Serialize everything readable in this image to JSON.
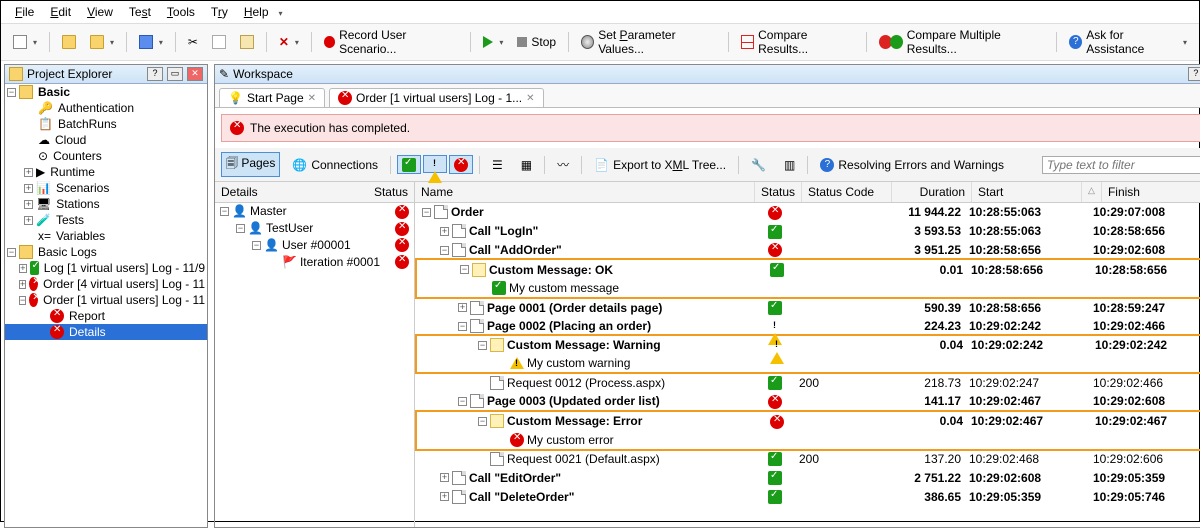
{
  "menu": {
    "file": "File",
    "edit": "Edit",
    "view": "View",
    "test": "Test",
    "tools": "Tools",
    "try": "Try",
    "help": "Help"
  },
  "toolbar": {
    "record": "Record User Scenario...",
    "stop": "Stop",
    "param": "Set Parameter Values...",
    "compare": "Compare Results...",
    "compareMulti": "Compare Multiple Results...",
    "ask": "Ask for Assistance"
  },
  "explorer": {
    "title": "Project Explorer",
    "basic": "Basic",
    "items": [
      "Authentication",
      "BatchRuns",
      "Cloud",
      "Counters",
      "Runtime",
      "Scenarios",
      "Stations",
      "Tests",
      "Variables"
    ],
    "logsTitle": "Basic Logs",
    "logs": [
      "Log [1 virtual users] Log -  11/9",
      "Order [4 virtual users] Log -  11",
      "Order [1 virtual users] Log -  11"
    ],
    "logChildren": [
      "Report",
      "Details"
    ]
  },
  "workspace": {
    "title": "Workspace",
    "tabs": [
      {
        "label": "Start Page"
      },
      {
        "label": "Order [1 virtual users] Log -  1..."
      }
    ],
    "banner": "The execution has completed.",
    "filter": {
      "pages": "Pages",
      "connections": "Connections",
      "export": "Export to XML Tree...",
      "resolving": "Resolving Errors and Warnings",
      "searchPlaceholder": "Type text to filter"
    },
    "detailsHdr": {
      "details": "Details",
      "status": "Status"
    },
    "details": [
      {
        "indent": 0,
        "exp": "-",
        "icon": "user",
        "label": "Master",
        "status": "err"
      },
      {
        "indent": 1,
        "exp": "-",
        "icon": "users",
        "label": "TestUser",
        "status": "err"
      },
      {
        "indent": 2,
        "exp": "-",
        "icon": "user",
        "label": "User #00001",
        "status": "err"
      },
      {
        "indent": 3,
        "exp": "",
        "icon": "flag",
        "label": "Iteration #0001",
        "status": "err"
      }
    ],
    "gridHdr": {
      "name": "Name",
      "status": "Status",
      "code": "Status Code",
      "dur": "Duration",
      "start": "Start",
      "finish": "Finish"
    },
    "rows": [
      {
        "i": 0,
        "exp": "-",
        "icon": "page",
        "bold": true,
        "name": "Order",
        "st": "err",
        "code": "",
        "dur": "11 944.22",
        "start": "10:28:55:063",
        "fin": "10:29:07:008"
      },
      {
        "i": 1,
        "exp": "+",
        "icon": "page",
        "bold": true,
        "name": "Call \"LogIn\"",
        "st": "ok",
        "code": "",
        "dur": "3 593.53",
        "start": "10:28:55:063",
        "fin": "10:28:58:656"
      },
      {
        "i": 1,
        "exp": "-",
        "icon": "page",
        "bold": true,
        "name": "Call \"AddOrder\"",
        "st": "err",
        "code": "",
        "dur": "3 951.25",
        "start": "10:28:58:656",
        "fin": "10:29:02:608"
      },
      {
        "i": 2,
        "exp": "-",
        "icon": "note",
        "bold": true,
        "name": "Custom Message: OK",
        "st": "ok",
        "code": "",
        "dur": "0.01",
        "start": "10:28:58:656",
        "fin": "10:28:58:656",
        "hl": "top"
      },
      {
        "i": 3,
        "exp": "",
        "icon": "ok",
        "bold": false,
        "name": "My custom message",
        "st": "",
        "code": "",
        "dur": "",
        "start": "",
        "fin": "",
        "hl": "bot"
      },
      {
        "i": 2,
        "exp": "+",
        "icon": "page",
        "bold": true,
        "name": "Page 0001 (Order details page)",
        "st": "ok",
        "code": "",
        "dur": "590.39",
        "start": "10:28:58:656",
        "fin": "10:28:59:247"
      },
      {
        "i": 2,
        "exp": "-",
        "icon": "page",
        "bold": true,
        "name": "Page 0002 (Placing an order)",
        "st": "warn",
        "code": "",
        "dur": "224.23",
        "start": "10:29:02:242",
        "fin": "10:29:02:466"
      },
      {
        "i": 3,
        "exp": "-",
        "icon": "note",
        "bold": true,
        "name": "Custom Message: Warning",
        "st": "warn",
        "code": "",
        "dur": "0.04",
        "start": "10:29:02:242",
        "fin": "10:29:02:242",
        "hl": "top"
      },
      {
        "i": 4,
        "exp": "",
        "icon": "warn",
        "bold": false,
        "name": "My custom warning",
        "st": "",
        "code": "",
        "dur": "",
        "start": "",
        "fin": "",
        "hl": "bot"
      },
      {
        "i": 3,
        "exp": "",
        "icon": "page",
        "bold": false,
        "name": "Request 0012 (Process.aspx)",
        "st": "ok",
        "code": "200",
        "dur": "218.73",
        "start": "10:29:02:247",
        "fin": "10:29:02:466"
      },
      {
        "i": 2,
        "exp": "-",
        "icon": "page",
        "bold": true,
        "name": "Page 0003 (Updated order list)",
        "st": "err",
        "code": "",
        "dur": "141.17",
        "start": "10:29:02:467",
        "fin": "10:29:02:608"
      },
      {
        "i": 3,
        "exp": "-",
        "icon": "note",
        "bold": true,
        "name": "Custom Message: Error",
        "st": "err",
        "code": "",
        "dur": "0.04",
        "start": "10:29:02:467",
        "fin": "10:29:02:467",
        "hl": "top"
      },
      {
        "i": 4,
        "exp": "",
        "icon": "err",
        "bold": false,
        "name": "My custom error",
        "st": "",
        "code": "",
        "dur": "",
        "start": "",
        "fin": "",
        "hl": "bot"
      },
      {
        "i": 3,
        "exp": "",
        "icon": "page",
        "bold": false,
        "name": "Request 0021 (Default.aspx)",
        "st": "ok",
        "code": "200",
        "dur": "137.20",
        "start": "10:29:02:468",
        "fin": "10:29:02:606"
      },
      {
        "i": 1,
        "exp": "+",
        "icon": "page",
        "bold": true,
        "name": "Call \"EditOrder\"",
        "st": "ok",
        "code": "",
        "dur": "2 751.22",
        "start": "10:29:02:608",
        "fin": "10:29:05:359"
      },
      {
        "i": 1,
        "exp": "+",
        "icon": "page",
        "bold": true,
        "name": "Call \"DeleteOrder\"",
        "st": "ok",
        "code": "",
        "dur": "386.65",
        "start": "10:29:05:359",
        "fin": "10:29:05:746"
      }
    ]
  }
}
